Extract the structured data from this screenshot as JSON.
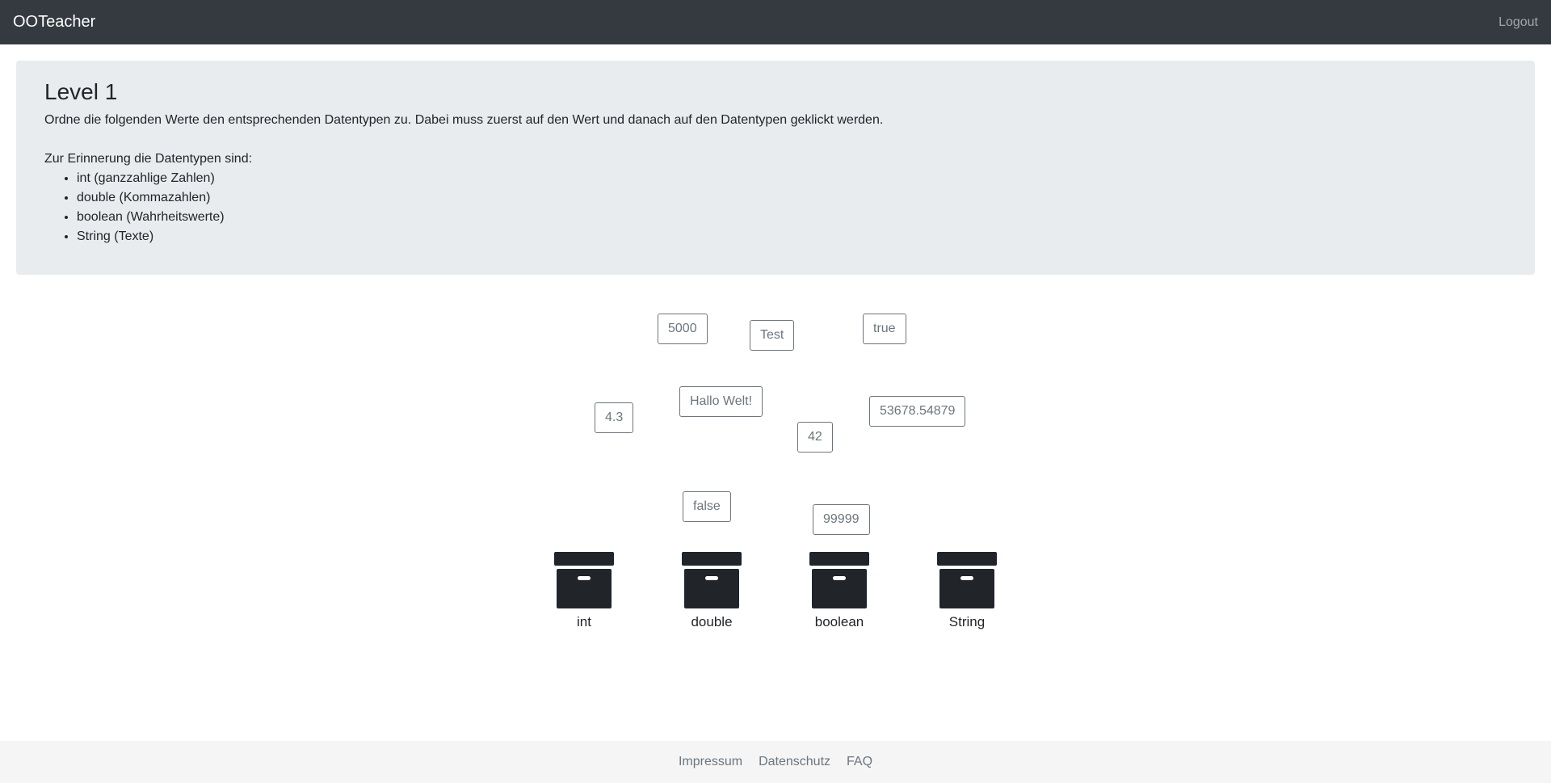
{
  "navbar": {
    "brand": "OOTeacher",
    "logout": "Logout"
  },
  "intro": {
    "title": "Level 1",
    "description": "Ordne die folgenden Werte den entsprechenden Datentypen zu. Dabei muss zuerst auf den Wert und danach auf den Datentypen geklickt werden.",
    "reminder": "Zur Erinnerung die Datentypen sind:",
    "types": [
      "int (ganzzahlige Zahlen)",
      "double (Kommazahlen)",
      "boolean (Wahrheitswerte)",
      "String (Texte)"
    ]
  },
  "values": [
    "5000",
    "Test",
    "true",
    "Hallo Welt!",
    "4.3",
    "53678.54879",
    "42",
    "false",
    "99999"
  ],
  "datatypes": [
    "int",
    "double",
    "boolean",
    "String"
  ],
  "footer": {
    "links": [
      "Impressum",
      "Datenschutz",
      "FAQ"
    ]
  },
  "colors": {
    "navbar": "#343a40",
    "jumbotron": "#e9ecef",
    "value_border": "#6c757d",
    "box": "#212529",
    "footer": "#f5f5f5"
  },
  "icons": {
    "datatype_box": "archive-box-icon"
  }
}
